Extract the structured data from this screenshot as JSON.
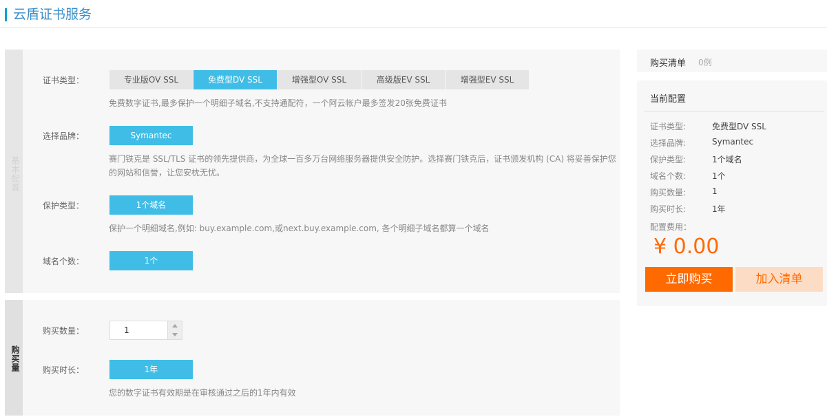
{
  "header": {
    "title": "云盾证书服务"
  },
  "config_section": {
    "tab_label": "基本配置",
    "cert_type": {
      "label": "证书类型：",
      "options": [
        "专业版OV SSL",
        "免费型DV SSL",
        "增强型OV SSL",
        "高级版EV SSL",
        "增强型EV SSL"
      ],
      "selected": "免费型DV SSL",
      "description": "免费数字证书,最多保护一个明细子域名,不支持通配符，一个阿云帐户最多签发20张免费证书"
    },
    "brand": {
      "label": "选择品牌：",
      "value": "Symantec",
      "description_line1": "赛门铁克是 SSL/TLS 证书的领先提供商，为全球一百多万台网络服务器提供安全防护。选择赛门铁克后，证书颁发机构 (CA) 将妥善保护您",
      "description_line2": "的网站和信誉，让您安枕无忧。"
    },
    "protect_type": {
      "label": "保护类型：",
      "value": "1个域名",
      "description": "保护一个明细域名,例如: buy.example.com,或next.buy.example.com, 各个明细子域名都算一个域名"
    },
    "domain_count": {
      "label": "域名个数：",
      "value": "1个"
    }
  },
  "purchase_section": {
    "tab_label": "购买量",
    "quantity": {
      "label": "购买数量：",
      "value": "1"
    },
    "duration": {
      "label": "购买时长：",
      "value": "1年",
      "description": "您的数字证书有效期是在审核通过之后的1年内有效"
    }
  },
  "cart": {
    "title": "购买清单",
    "count": "0例"
  },
  "summary": {
    "title": "当前配置",
    "rows": [
      {
        "key": "证书类型:",
        "value": "免费型DV SSL"
      },
      {
        "key": "选择品牌:",
        "value": "Symantec"
      },
      {
        "key": "保护类型:",
        "value": "1个域名"
      },
      {
        "key": "域名个数:",
        "value": "1个"
      },
      {
        "key": "购买数量:",
        "value": "1"
      },
      {
        "key": "购买时长:",
        "value": "1年"
      }
    ],
    "fee_label": "配置费用：",
    "price": "¥ 0.00",
    "buy_button": "立即购买",
    "add_button": "加入清单"
  },
  "colors": {
    "accent": "#3fbde6",
    "brand_orange": "#ff6a00",
    "title_blue": "#3a8ec9"
  }
}
